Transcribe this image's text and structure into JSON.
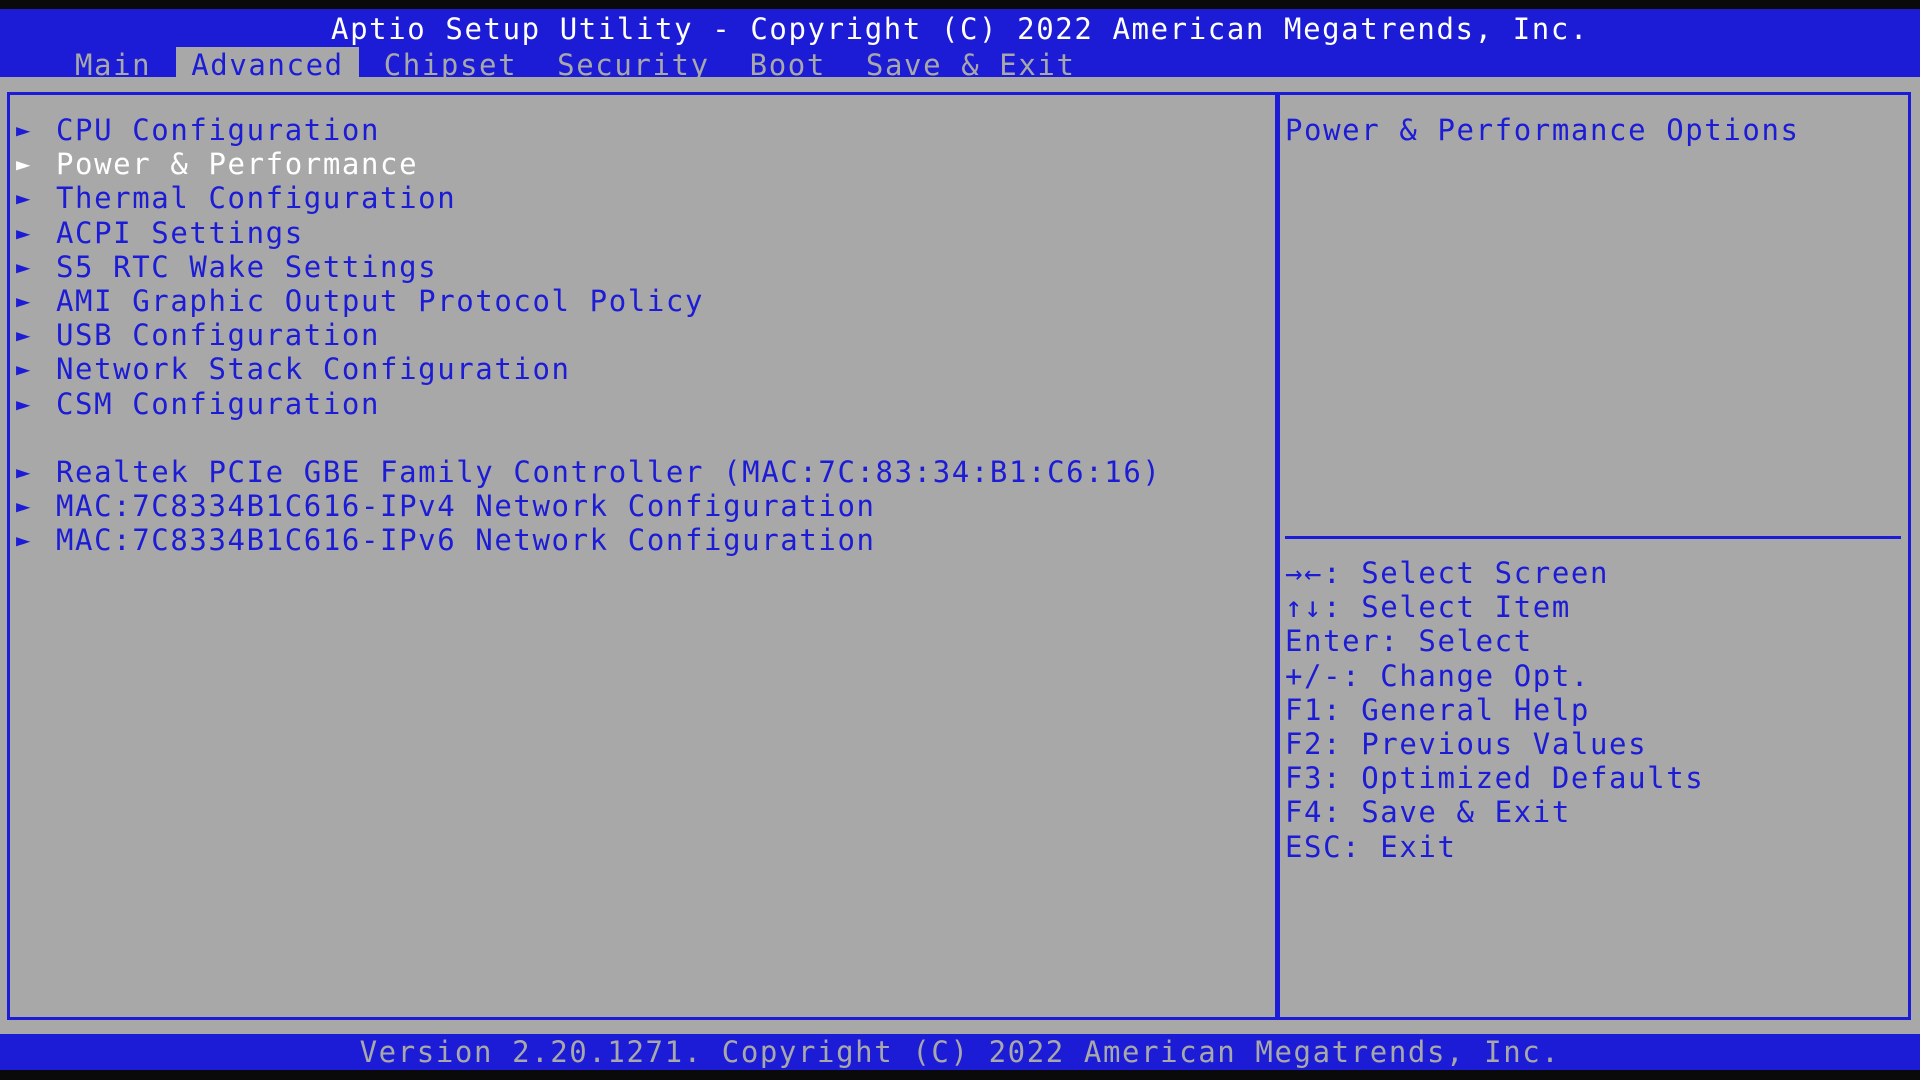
{
  "header": {
    "title": "Aptio Setup Utility - Copyright (C) 2022 American Megatrends, Inc.",
    "tabs": [
      {
        "label": "Main"
      },
      {
        "label": "Advanced"
      },
      {
        "label": "Chipset"
      },
      {
        "label": "Security"
      },
      {
        "label": "Boot"
      },
      {
        "label": "Save & Exit"
      }
    ],
    "active_tab": "Advanced"
  },
  "menu": {
    "arrow_icon": "►",
    "items": [
      {
        "label": "CPU Configuration"
      },
      {
        "label": "Power & Performance"
      },
      {
        "label": "Thermal Configuration"
      },
      {
        "label": "ACPI Settings"
      },
      {
        "label": "S5 RTC Wake Settings"
      },
      {
        "label": "AMI Graphic Output Protocol Policy"
      },
      {
        "label": "USB Configuration"
      },
      {
        "label": "Network Stack Configuration"
      },
      {
        "label": "CSM Configuration"
      },
      {
        "label": "Realtek PCIe GBE Family Controller (MAC:7C:83:34:B1:C6:16)"
      },
      {
        "label": "MAC:7C8334B1C616-IPv4 Network Configuration"
      },
      {
        "label": "MAC:7C8334B1C616-IPv6 Network Configuration"
      }
    ],
    "selected": "Power & Performance"
  },
  "help": {
    "description": "Power & Performance Options",
    "keys": [
      "→←: Select Screen",
      "↑↓: Select Item",
      "Enter: Select",
      "+/-: Change Opt.",
      "F1: General Help",
      "F2: Previous Values",
      "F3: Optimized Defaults",
      "F4: Save & Exit",
      "ESC: Exit"
    ]
  },
  "footer": {
    "version": "Version 2.20.1271. Copyright (C) 2022 American Megatrends, Inc."
  },
  "colors": {
    "bios_blue": "#1c1cd6",
    "bios_gray": "#a8a8a8",
    "highlight_white": "#ffffff"
  }
}
